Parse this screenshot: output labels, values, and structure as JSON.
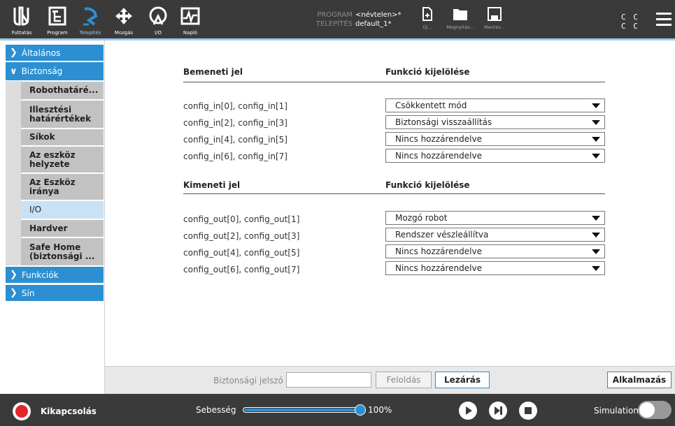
{
  "topbar": {
    "nav": [
      {
        "label": "Futtatás",
        "icon": "ur-logo-icon"
      },
      {
        "label": "Program",
        "icon": "program-tree-icon"
      },
      {
        "label": "Telepítés",
        "icon": "installation-icon"
      },
      {
        "label": "Mozgás",
        "icon": "move-arrows-icon"
      },
      {
        "label": "I/O",
        "icon": "io-icon"
      },
      {
        "label": "Napló",
        "icon": "log-icon"
      }
    ],
    "program_key": "PROGRAM",
    "program_value": "<névtelen>*",
    "install_key": "TELEPÍTÉS",
    "install_value": "default_1*",
    "file_buttons": [
      {
        "label": "Új...",
        "icon": "new-file-icon"
      },
      {
        "label": "Megnyitás...",
        "icon": "folder-icon"
      },
      {
        "label": "Mentés...",
        "icon": "save-icon"
      }
    ],
    "cc_line1": "C C",
    "cc_line2": "C C"
  },
  "sidebar": {
    "top_items": [
      {
        "label": "Általános",
        "chevron": ">"
      },
      {
        "label": "Biztonság",
        "chevron": "v"
      },
      {
        "label": "Funkciók",
        "chevron": ">"
      },
      {
        "label": "Sín",
        "chevron": ">"
      }
    ],
    "sub_items": [
      {
        "label": "Robothatáré..."
      },
      {
        "label": "Illesztési határértékek"
      },
      {
        "label": "Síkok"
      },
      {
        "label": "Az eszköz helyzete"
      },
      {
        "label": "Az Eszköz iránya"
      },
      {
        "label": "I/O"
      },
      {
        "label": "Hardver"
      },
      {
        "label": "Safe Home (biztonsági ..."
      }
    ]
  },
  "inputs": {
    "header_signal": "Bemeneti jel",
    "header_function": "Funkció kijelölése",
    "rows": [
      {
        "signal": "config_in[0], config_in[1]",
        "value": "Csökkentett mód"
      },
      {
        "signal": "config_in[2], config_in[3]",
        "value": "Biztonsági visszaállítás"
      },
      {
        "signal": "config_in[4], config_in[5]",
        "value": "Nincs hozzárendelve"
      },
      {
        "signal": "config_in[6], config_in[7]",
        "value": "Nincs hozzárendelve"
      }
    ]
  },
  "outputs": {
    "header_signal": "Kimeneti jel",
    "header_function": "Funkció kijelölése",
    "rows": [
      {
        "signal": "config_out[0], config_out[1]",
        "value": "Mozgó robot"
      },
      {
        "signal": "config_out[2], config_out[3]",
        "value": "Rendszer vészleállítva"
      },
      {
        "signal": "config_out[4], config_out[5]",
        "value": "Nincs hozzárendelve"
      },
      {
        "signal": "config_out[6], config_out[7]",
        "value": "Nincs hozzárendelve"
      }
    ]
  },
  "footer": {
    "password_label": "Biztonsági jelszó",
    "password_value": "",
    "unlock_label": "Feloldás",
    "lock_label": "Lezárás",
    "apply_label": "Alkalmazás"
  },
  "bottombar": {
    "power_label": "Kikapcsolás",
    "speed_label": "Sebesség",
    "speed_value": "100%",
    "speed_fraction": 1.0,
    "simulation_label": "Simulation",
    "simulation_on": false
  },
  "colors": {
    "accent": "#2c8fd1",
    "dark_bar": "#3a3a3a",
    "power_red": "#e4262a"
  }
}
